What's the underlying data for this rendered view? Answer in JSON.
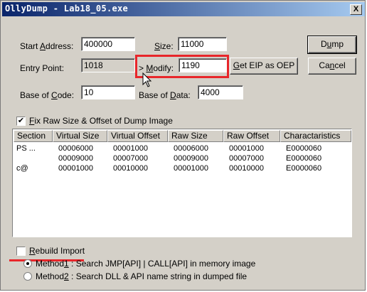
{
  "window": {
    "title": "OllyDump - Lab18_05.exe",
    "close_label": "X"
  },
  "fields": {
    "start_address": {
      "label_pre": "Start ",
      "label_u": "A",
      "label_post": "ddress:",
      "value": "400000"
    },
    "size": {
      "label_u": "S",
      "label_post": "ize:",
      "value": "11000"
    },
    "entry_point": {
      "label": "Entry Point:",
      "value": "1018"
    },
    "modify": {
      "label_pre": "> ",
      "label_u": "M",
      "label_post": "odify:",
      "value": "1190"
    },
    "base_of_code": {
      "label_pre": "Base of ",
      "label_u": "C",
      "label_post": "ode:",
      "value": "10"
    },
    "base_of_data": {
      "label_pre": "Base of ",
      "label_u": "D",
      "label_post": "ata:",
      "value": "4000"
    }
  },
  "buttons": {
    "dump": {
      "pre": "D",
      "u": "u",
      "post": "mp"
    },
    "cancel": {
      "pre": "Ca",
      "u": "n",
      "post": "cel"
    },
    "get_eip": {
      "pre": "",
      "u": "G",
      "post": "et EIP as OEP"
    }
  },
  "fix_raw": {
    "checked": true,
    "mark": "✔",
    "label_u": "F",
    "label_post": "ix Raw Size & Offset of Dump Image"
  },
  "table": {
    "columns": [
      "Section",
      "Virtual Size",
      "Virtual Offset",
      "Raw Size",
      "Raw Offset",
      "Charactaristics"
    ],
    "rows": [
      [
        "PS    ...",
        "00006000",
        "00001000",
        "00006000",
        "00001000",
        "E0000060"
      ],
      [
        "",
        "00009000",
        "00007000",
        "00009000",
        "00007000",
        "E0000060"
      ],
      [
        "  c@",
        "00001000",
        "00010000",
        "00001000",
        "00010000",
        "E0000060"
      ]
    ]
  },
  "rebuild_import": {
    "checked": false,
    "label_u": "R",
    "label_post": "ebuild Import"
  },
  "methods": [
    {
      "pre": "Method",
      "u": "1",
      "post": " : Search JMP[API] | CALL[API] in memory image",
      "selected": true
    },
    {
      "pre": "Method",
      "u": "2",
      "post": " : Search DLL & API name string in dumped file",
      "selected": false
    }
  ]
}
